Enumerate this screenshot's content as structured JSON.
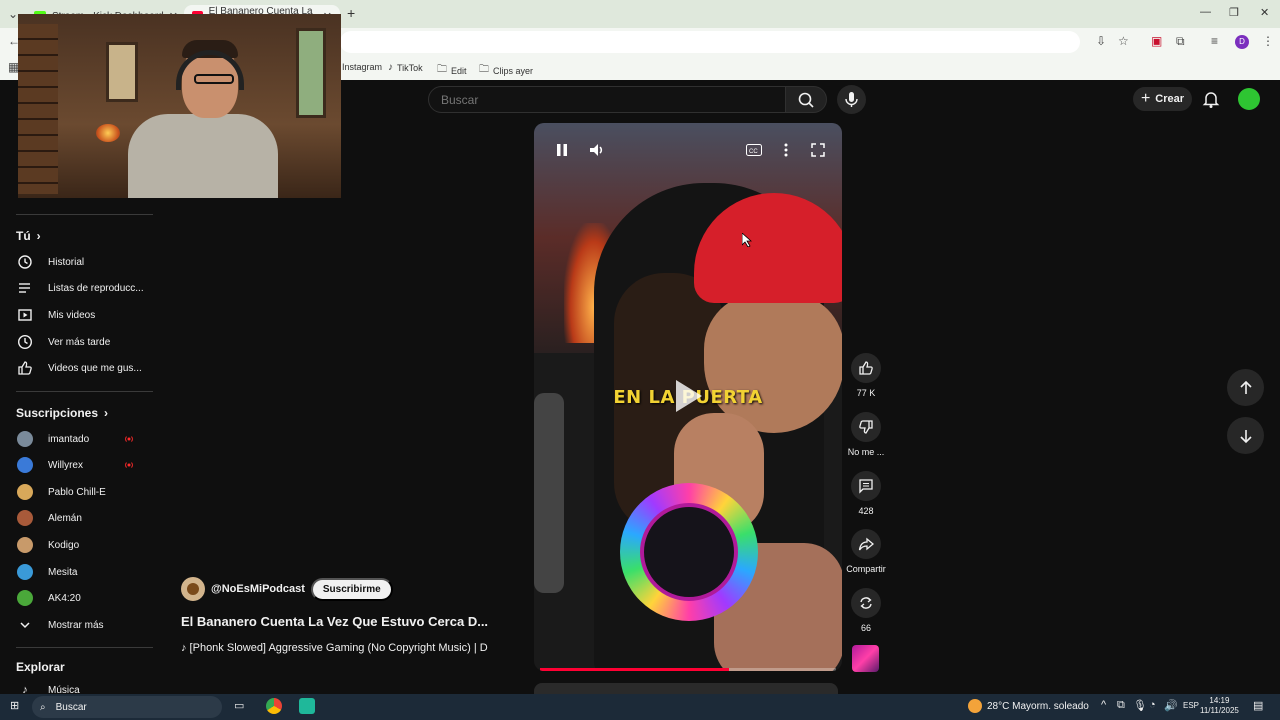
{
  "browser": {
    "tabs": [
      {
        "title": "Stream - Kick Dashboard",
        "active": false,
        "icon_color": "#53fc18"
      },
      {
        "title": "El Bananero Cuenta La Vez Qu",
        "active": true,
        "icon_color": "#ff0033"
      }
    ],
    "new_tab_icon": "plus-icon",
    "bookmarks": [
      {
        "label": "Instagram",
        "icon": "instagram-icon"
      },
      {
        "label": "TikTok",
        "icon": "tiktok-icon"
      },
      {
        "label": "Edit",
        "icon": "folder-icon"
      },
      {
        "label": "Clips ayer",
        "icon": "folder-icon"
      }
    ],
    "profile_initial": "D"
  },
  "header": {
    "search_placeholder": "Buscar",
    "create_label": "Crear"
  },
  "sidebar": {
    "you": {
      "title": "Tú",
      "items": [
        {
          "label": "Historial",
          "icon": "history-icon"
        },
        {
          "label": "Listas de reproducc...",
          "icon": "playlist-icon"
        },
        {
          "label": "Mis videos",
          "icon": "my-videos-icon"
        },
        {
          "label": "Ver más tarde",
          "icon": "clock-icon"
        },
        {
          "label": "Videos que me gus...",
          "icon": "thumbs-up-icon"
        }
      ]
    },
    "subscriptions": {
      "title": "Suscripciones",
      "items": [
        {
          "label": "imantado",
          "live": true,
          "color": "#7a8a9a"
        },
        {
          "label": "Willyrex",
          "live": true,
          "color": "#3a7ad8"
        },
        {
          "label": "Pablo Chill-E",
          "live": false,
          "color": "#d8a85a"
        },
        {
          "label": "Alemán",
          "live": false,
          "color": "#a85a3a"
        },
        {
          "label": "Kodigo",
          "live": false,
          "color": "#c89a6a"
        },
        {
          "label": "Mesita",
          "live": false,
          "color": "#3a9ad8"
        },
        {
          "label": "AK4:20",
          "live": false,
          "color": "#4aa83a"
        }
      ],
      "show_more": "Mostrar más"
    },
    "explore": {
      "title": "Explorar",
      "items": [
        {
          "label": "Música",
          "icon": "music-icon"
        }
      ]
    }
  },
  "short": {
    "caption": "EN LA PUERTA",
    "channel": "@NoEsMiPodcast",
    "subscribe_label": "Suscribirme",
    "title": "El Bananero Cuenta La Vez Que Estuvo Cerca D...",
    "music": "♪ [Phonk Slowed] Aggressive Gaming (No Copyright Music) | D",
    "progress": 0.64,
    "actions": {
      "likes": "77 K",
      "dislike": "No me ...",
      "comments": "428",
      "share": "Compartir",
      "remix": "66"
    }
  },
  "taskbar": {
    "search_placeholder": "Buscar",
    "weather": "28°C  Mayorm. soleado",
    "language": "ESP",
    "time": "14:19",
    "date": "11/11/2025"
  }
}
